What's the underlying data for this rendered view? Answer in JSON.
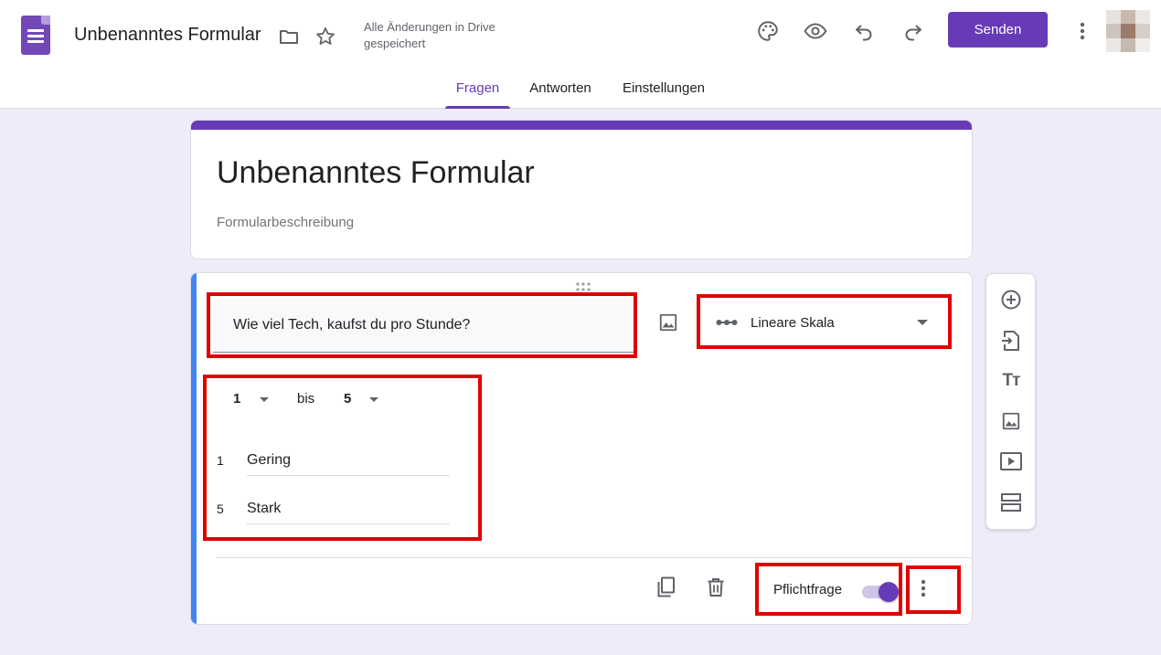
{
  "header": {
    "doc_title": "Unbenanntes Formular",
    "save_status": "Alle Änderungen in Drive gespeichert",
    "send_label": "Senden",
    "icons": [
      "forms-logo-icon",
      "folder-icon",
      "star-icon",
      "palette-icon",
      "preview-eye-icon",
      "undo-icon",
      "redo-icon",
      "more-vert-icon",
      "avatar"
    ]
  },
  "tabs": [
    {
      "label": "Fragen",
      "active": true
    },
    {
      "label": "Antworten",
      "active": false
    },
    {
      "label": "Einstellungen",
      "active": false
    }
  ],
  "form": {
    "title": "Unbenanntes Formular",
    "description_placeholder": "Formularbeschreibung"
  },
  "question": {
    "text": "Wie viel Tech, kaufst du pro Stunde?",
    "type_label": "Lineare Skala",
    "range_from": "1",
    "range_to_word": "bis",
    "range_to": "5",
    "labels": [
      {
        "num": "1",
        "text": "Gering"
      },
      {
        "num": "5",
        "text": "Stark"
      }
    ],
    "required_label": "Pflichtfrage",
    "required": true
  },
  "side_toolbar": {
    "icons": [
      "add-question-icon",
      "import-questions-icon",
      "add-title-icon",
      "add-image-icon",
      "add-video-icon",
      "add-section-icon"
    ],
    "title_glyph": "Tт"
  },
  "colors": {
    "accent": "#673ab7",
    "background": "#f0ebf8",
    "active_question": "#4285f4",
    "annotation": "#e00000"
  }
}
